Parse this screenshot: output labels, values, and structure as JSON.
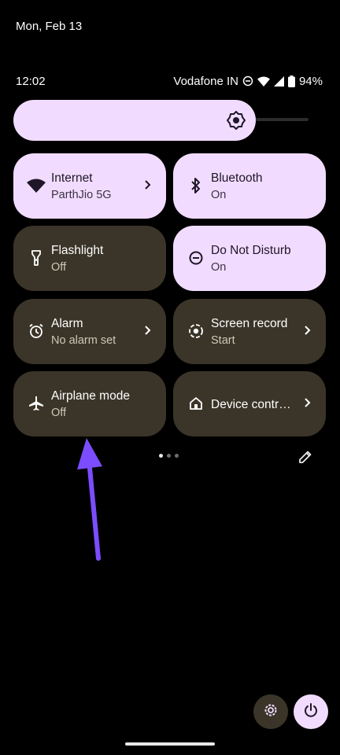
{
  "lockscreen": {
    "date": "Mon, Feb 13"
  },
  "status_bar": {
    "time": "12:02",
    "carrier": "Vodafone IN",
    "battery": "94%",
    "icons": [
      "dnd-icon",
      "wifi-icon",
      "signal-icon",
      "battery-icon"
    ]
  },
  "brightness": {
    "icon": "brightness-icon"
  },
  "tiles": [
    {
      "title": "Internet",
      "subtitle": "ParthJio 5G",
      "state": "on",
      "icon": "wifi-icon",
      "chevron": true
    },
    {
      "title": "Bluetooth",
      "subtitle": "On",
      "state": "on",
      "icon": "bluetooth-icon",
      "chevron": false
    },
    {
      "title": "Flashlight",
      "subtitle": "Off",
      "state": "off",
      "icon": "flashlight-icon",
      "chevron": false
    },
    {
      "title": "Do Not Disturb",
      "subtitle": "On",
      "state": "on",
      "icon": "dnd-icon",
      "chevron": false
    },
    {
      "title": "Alarm",
      "subtitle": "No alarm set",
      "state": "off",
      "icon": "alarm-icon",
      "chevron": true
    },
    {
      "title": "Screen record",
      "subtitle": "Start",
      "state": "off",
      "icon": "screen-record-icon",
      "chevron": true
    },
    {
      "title": "Airplane mode",
      "subtitle": "Off",
      "state": "off",
      "icon": "airplane-icon",
      "chevron": false
    },
    {
      "title": "Device contr…",
      "subtitle": "",
      "state": "off",
      "icon": "home-icon",
      "chevron": true
    }
  ],
  "pager": {
    "pages": 3,
    "current": 1
  },
  "bottom_controls": {
    "settings_icon": "gear-icon",
    "power_icon": "power-icon"
  },
  "annotation": {
    "arrow_color": "#7b4dff",
    "points_to": "airplane-mode"
  },
  "colors": {
    "tile_on": "#f1dcff",
    "tile_off": "#3a3528",
    "background": "#000000"
  }
}
